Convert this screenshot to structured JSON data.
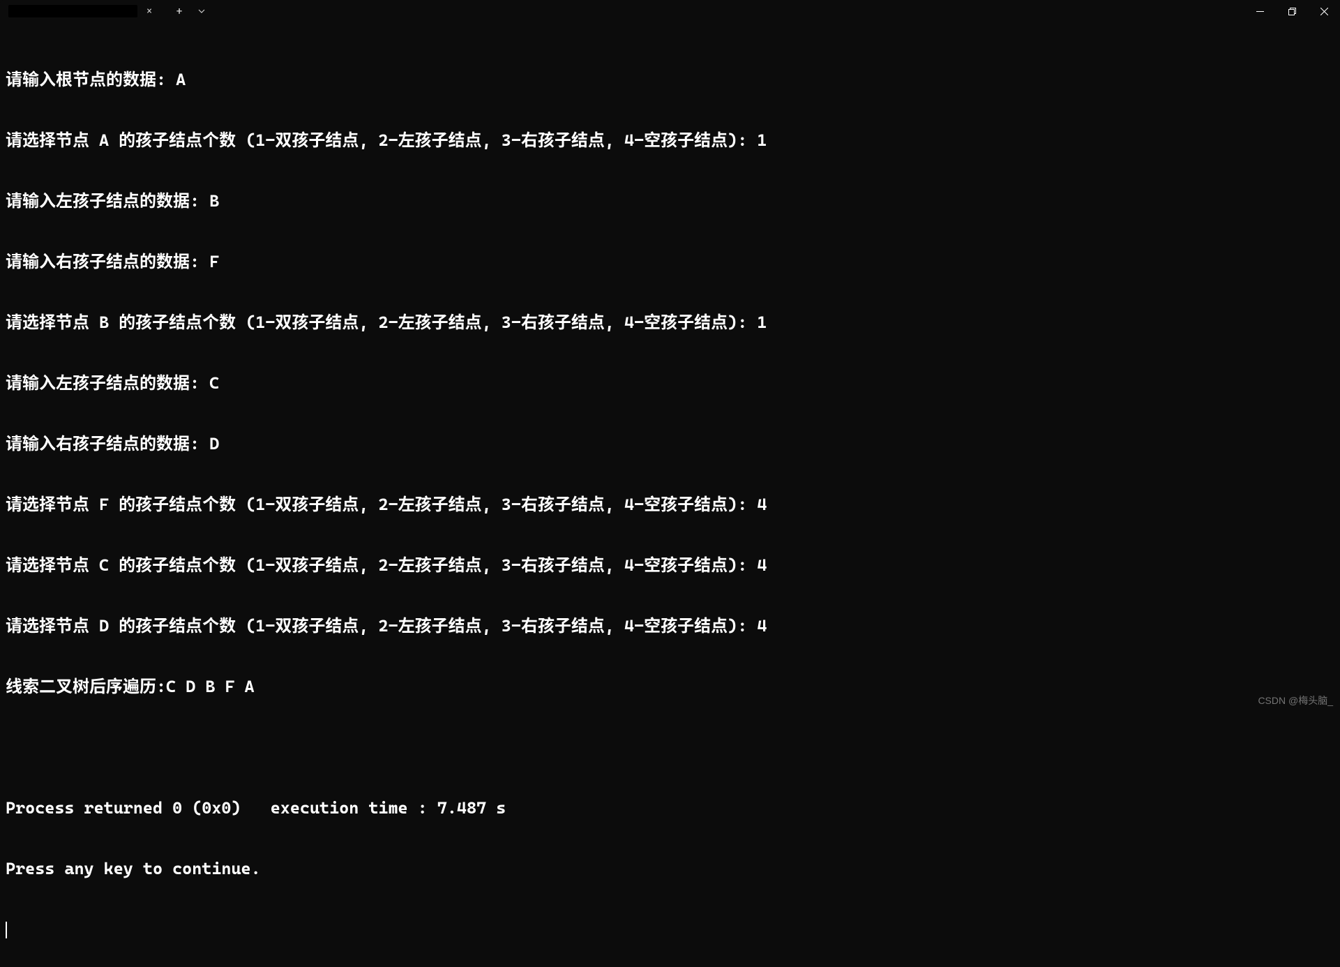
{
  "titlebar": {
    "tab_close_glyph": "×",
    "new_tab_glyph": "+"
  },
  "terminal": {
    "lines": [
      "请输入根节点的数据: A",
      "请选择节点 A 的孩子结点个数 (1-双孩子结点, 2-左孩子结点, 3-右孩子结点, 4-空孩子结点): 1",
      "请输入左孩子结点的数据: B",
      "请输入右孩子结点的数据: F",
      "请选择节点 B 的孩子结点个数 (1-双孩子结点, 2-左孩子结点, 3-右孩子结点, 4-空孩子结点): 1",
      "请输入左孩子结点的数据: C",
      "请输入右孩子结点的数据: D",
      "请选择节点 F 的孩子结点个数 (1-双孩子结点, 2-左孩子结点, 3-右孩子结点, 4-空孩子结点): 4",
      "请选择节点 C 的孩子结点个数 (1-双孩子结点, 2-左孩子结点, 3-右孩子结点, 4-空孩子结点): 4",
      "请选择节点 D 的孩子结点个数 (1-双孩子结点, 2-左孩子结点, 3-右孩子结点, 4-空孩子结点): 4",
      "线索二叉树后序遍历:C D B F A",
      "",
      "Process returned 0 (0x0)   execution time : 7.487 s",
      "Press any key to continue."
    ]
  },
  "watermark": "CSDN @梅头脑_"
}
